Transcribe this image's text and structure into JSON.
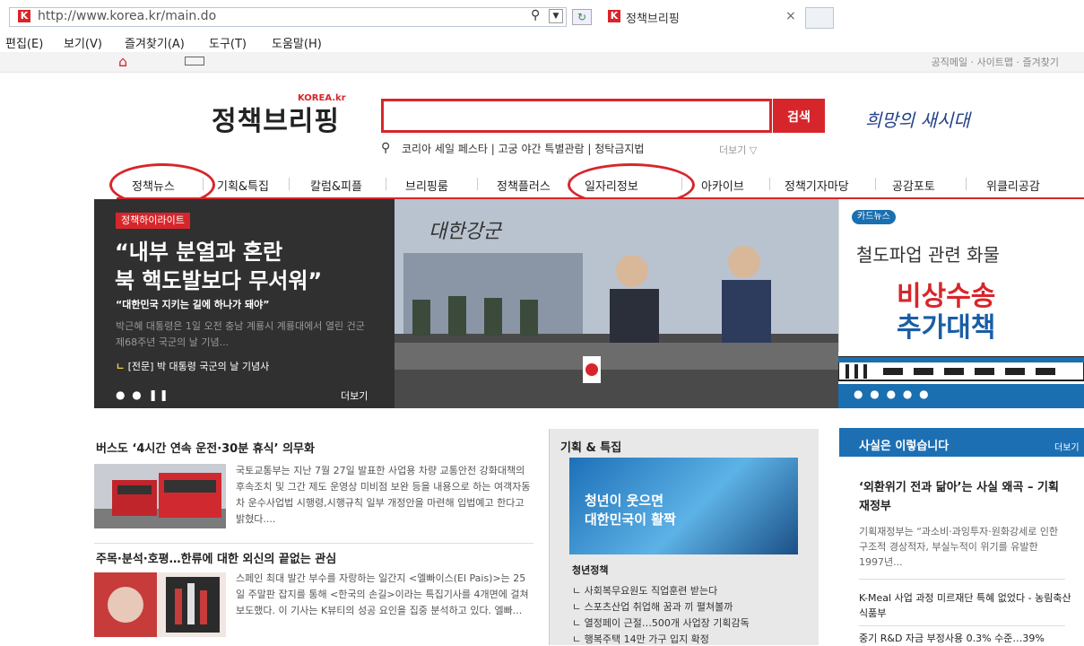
{
  "browser": {
    "url": "http://www.korea.kr/main.do",
    "tab_title": "정책브리핑",
    "tab_close": "×",
    "menu": [
      "편집(E)",
      "보기(V)",
      "즐겨찾기(A)",
      "도구(T)",
      "도움말(H)"
    ]
  },
  "site": {
    "top_util": "공직메일 · 사이트맵 · 즐겨찾기",
    "logo_small": "KOREA.kr",
    "logo": "정책브리핑",
    "search_button": "검색",
    "slogan": "희망의 새시대",
    "keywords": "코리아 세일 페스타  |  고궁 야간 특별관람  |  청탁금지법",
    "keywords_more": "더보기 ▽"
  },
  "nav": [
    "정책뉴스",
    "기획&특집",
    "칼럼&피플",
    "브리핑룸",
    "정책플러스",
    "일자리정보",
    "아카이브",
    "정책기자마당",
    "공감포토",
    "위클리공감"
  ],
  "hero": {
    "badge": "정책하이라이트",
    "title_line1": "“내부 분열과 혼란",
    "title_line2": "북 핵도발보다 무서워”",
    "subtitle": "“대한민국 지키는 길에 하나가 돼야”",
    "desc": "박근혜 대통령은 1일 오전 충남 계룡시 계룡대에서 열린 건군 제68주년 국군의 날 기념...",
    "link_mark": "ㄴ",
    "link": "[전문] 박 대통령 국군의 날 기념사",
    "dots": "● ● ❚❚",
    "more": "더보기",
    "photo_caption": "대한강군"
  },
  "card": {
    "badge": "카드뉴스",
    "line1": "철도파업 관련 화물",
    "line2": "비상수송",
    "line3": "추가대책",
    "dots": "● ● ● ● ●"
  },
  "news": [
    {
      "title": "버스도 ‘4시간 연속 운전·30분 휴식’ 의무화",
      "body": "국토교통부는 지난 7월 27일 발표한 사업용 차량 교통안전 강화대책의 후속조치 및 그간 제도 운영상 미비점 보완 등을 내용으로 하는 여객자동차 운수사업법 시행령,시행규칙 일부 개정안을 마련해 입법예고 한다고 밝혔다...."
    },
    {
      "title": "주목·분석·호평…한류에 대한 외신의 끝없는 관심",
      "body": "스페인 최대 발간 부수를 자랑하는 일간지 <엘빠이스(El Pais)>는 25일 주말판 잡지를 통해 <한국의 손길>이라는 특집기사를 4개면에 걸쳐 보도했다. 이 기사는 K뷰티의 성공 요인을 집중 분석하고 있다. 엘빠..."
    }
  ],
  "feature": {
    "header": "기획 & 특집",
    "img_line1": "청년이 웃으면",
    "img_line2": "대한민국이 활짝",
    "category": "청년정책",
    "items": [
      "ㄴ 사회복무요원도 직업훈련 받는다",
      "ㄴ 스포츠산업 취업해 꿈과 끼 펼쳐볼까",
      "ㄴ 열정페이 근절…500개 사업장 기획감독",
      "ㄴ 행복주택 14만 가구 입지 확정"
    ]
  },
  "facts": {
    "title": "사실은 이렇습니다",
    "more": "더보기",
    "head1": "‘외환위기 전과 닮아’는 사실 왜곡 – 기획재정부",
    "body1": "기획재정부는 “과소비·과잉투자·원화강세로 인한 구조적 경상적자, 부실누적이 위기를 유발한 1997년...",
    "head2": "K-Meal 사업 과정 미르재단 특혜 없었다 - 농림축산식품부",
    "head3": "중기 R&D 자금 부정사용 0.3% 수준…39%"
  }
}
